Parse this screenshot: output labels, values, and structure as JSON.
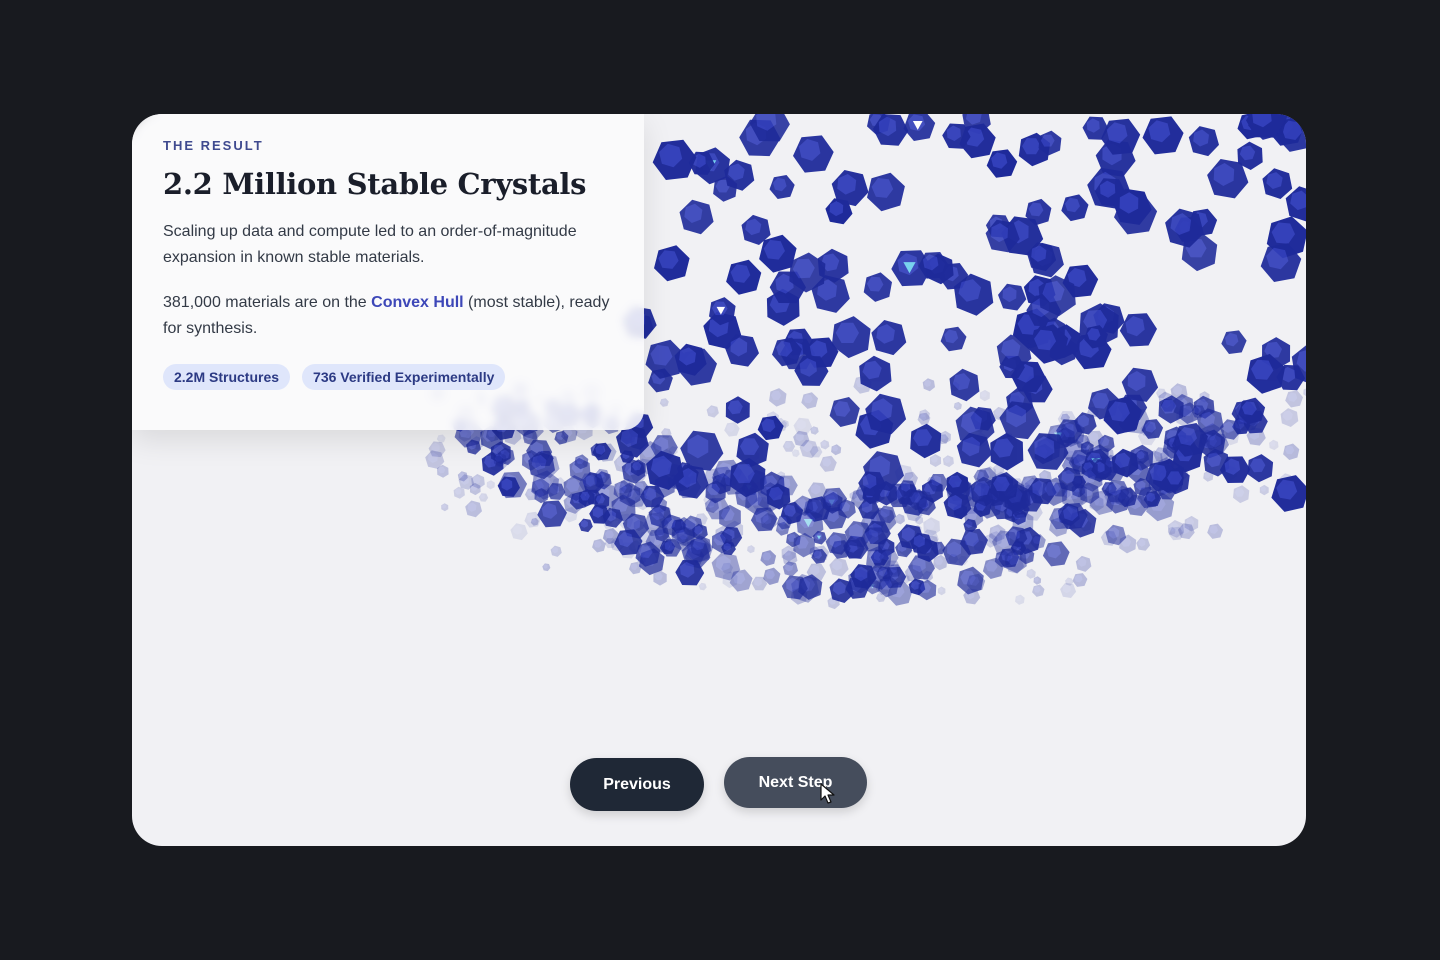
{
  "card": {
    "eyebrow": "THE RESULT",
    "title": "2.2 Million Stable Crystals",
    "description": "Scaling up data and compute led to an order-of-magnitude expansion in known stable materials.",
    "stat_prefix": "381,000 materials are on the ",
    "stat_link": "Convex Hull",
    "stat_suffix": " (most stable), ready for synthesis.",
    "badges": [
      "2.2M Structures",
      "736 Verified Experimentally"
    ]
  },
  "navigation": {
    "previous_label": "Previous",
    "next_label": "Next Step"
  },
  "colors": {
    "page_background": "#181a1f",
    "stage_background": "#f1f1f4",
    "crystal": "#1e2a9a",
    "crystal_light": "#3a47c4",
    "crystal_highlight": "#6fd0ee",
    "accent_link": "#3d47b8",
    "badge_background": "#dfe6fb"
  },
  "icons": {
    "crystal": "icosahedron-crystal-icon",
    "cursor": "mouse-pointer-icon"
  }
}
